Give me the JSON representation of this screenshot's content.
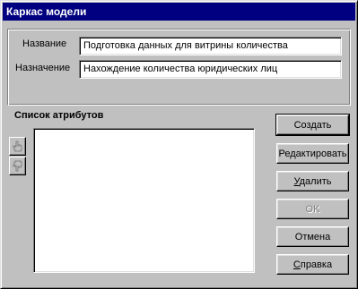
{
  "window": {
    "title": "Каркас модели"
  },
  "form": {
    "name_label": "Название",
    "name_value": "Подготовка данных для витрины количества",
    "purpose_label": "Назначение",
    "purpose_value": "Нахождение количества юридических лиц"
  },
  "attributes": {
    "title": "Список атрибутов",
    "items": [],
    "move_up_icon": "hand-up-icon",
    "move_down_icon": "hand-down-icon"
  },
  "buttons": {
    "create": "Создать",
    "edit": "Редактировать",
    "delete_first": "У",
    "delete_rest": "далить",
    "ok": "OK",
    "cancel": "Отмена",
    "help_first": "С",
    "help_rest": "правка"
  }
}
